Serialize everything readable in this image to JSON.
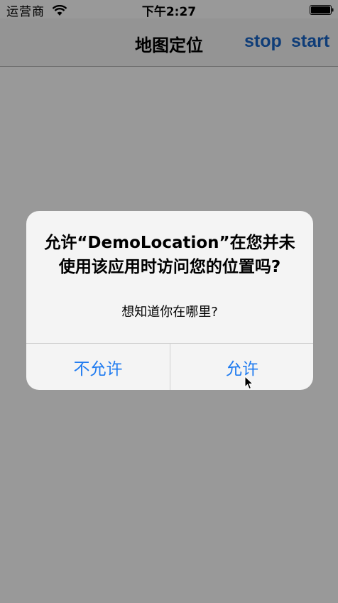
{
  "status_bar": {
    "carrier": "运营商",
    "time": "下午2:27"
  },
  "nav_bar": {
    "title": "地图定位",
    "stop_label": "stop",
    "start_label": "start"
  },
  "alert": {
    "title": "允许“DemoLocation”在您并未使用该应用时访问您的位置吗?",
    "message": "想知道你在哪里?",
    "deny_label": "不允许",
    "allow_label": "允许"
  },
  "colors": {
    "nav_accent": "#1a66c8",
    "alert_button": "#1f7bf0",
    "overlay": "rgba(0,0,0,0.4)"
  },
  "icons": {
    "wifi": "wifi-icon",
    "battery": "battery-icon",
    "cursor": "mouse-cursor-icon"
  }
}
